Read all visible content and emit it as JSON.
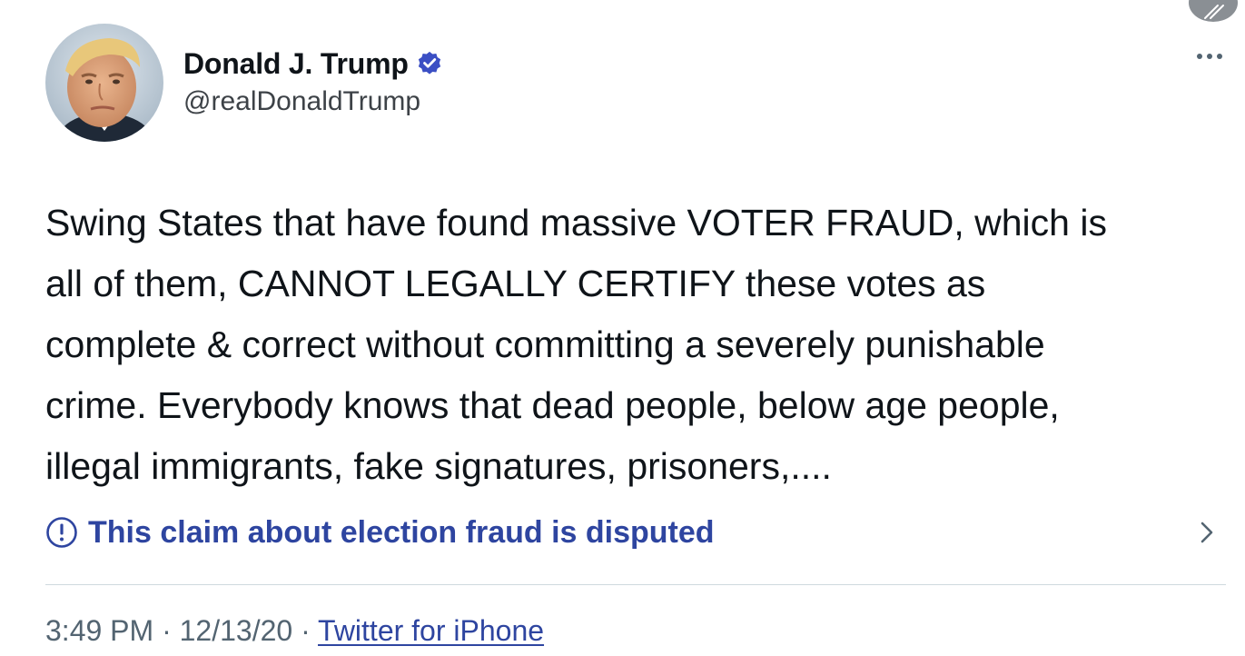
{
  "author": {
    "display_name": "Donald J. Trump",
    "handle": "@realDonaldTrump",
    "verified": true
  },
  "tweet": {
    "lines": [
      "Swing States that have found massive VOTER FRAUD, which is",
      "all of them, CANNOT LEGALLY CERTIFY these votes as",
      "complete & correct without committing a severely punishable",
      "crime. Everybody knows that dead people, below age people,",
      "illegal immigrants, fake signatures, prisoners,...."
    ]
  },
  "notice": {
    "text": "This claim about election fraud is disputed",
    "icon": "info-circle-icon",
    "chevron_icon": "chevron-right-icon"
  },
  "meta": {
    "time": "3:49 PM",
    "separator": " · ",
    "date": "12/13/20",
    "source": "Twitter for iPhone"
  },
  "icons": {
    "more": "more-dots-icon",
    "verified": "verified-badge-icon",
    "corner": "expand-arrows-icon"
  },
  "colors": {
    "text": "#0f1419",
    "secondary": "#536471",
    "link_blue": "#2e45a0",
    "verified_blue": "#3b4fc4",
    "divider": "#cfd9de"
  }
}
